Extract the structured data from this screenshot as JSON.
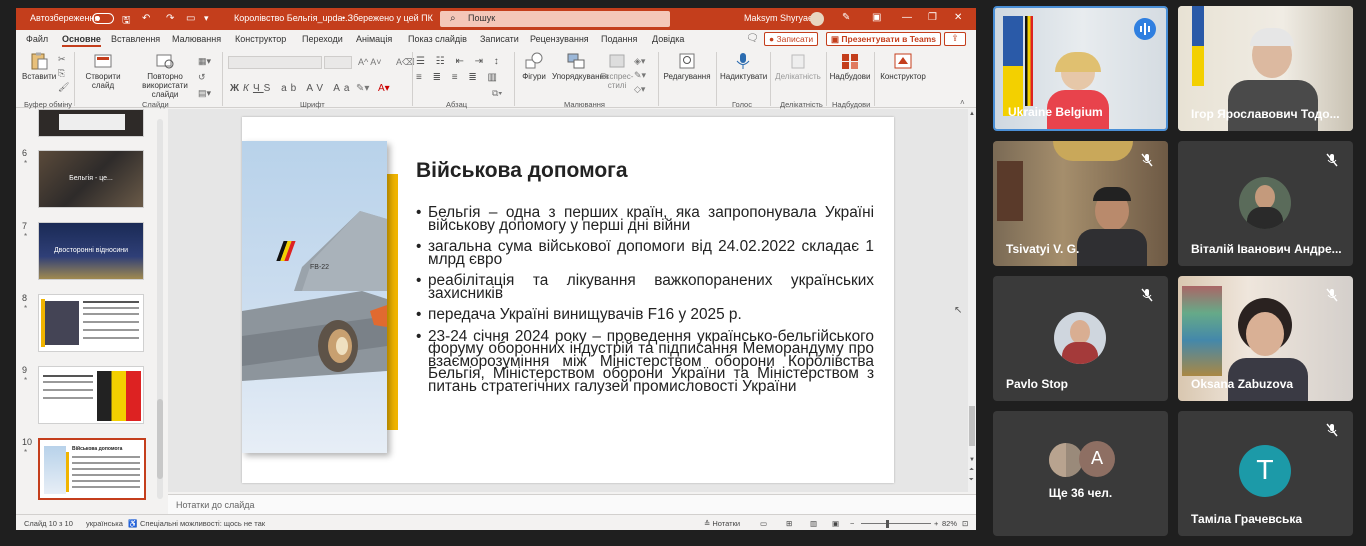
{
  "ppt": {
    "titlebar": {
      "autosave_label": "Автозбереження",
      "doc_title": "Королівство Бельгія_upda...",
      "saved_status": "• Збережено у цей ПК",
      "search_placeholder": "Пошук",
      "user_name": "Maksym Shyryaev"
    },
    "menu": [
      "Файл",
      "Основне",
      "Вставлення",
      "Малювання",
      "Конструктор",
      "Переходи",
      "Анімація",
      "Показ слайдів",
      "Записати",
      "Рецензування",
      "Подання",
      "Довідка"
    ],
    "menu_active": "Основне",
    "record_label": "Записати",
    "teams_label": "Презентувати в Teams",
    "ribbon": {
      "paste": "Вставити",
      "clipboard_group": "Буфер обміну",
      "new_slide": "Створити слайд",
      "reuse_slides": "Повторно використати слайди",
      "slides_group": "Слайди",
      "font_group": "Шрифт",
      "paragraph_group": "Абзац",
      "shapes": "Фігури",
      "arrange": "Упорядкування",
      "quick_styles": "Експрес-стилі",
      "drawing_group": "Малювання",
      "editing": "Редагування",
      "dictate": "Надиктувати",
      "voice_group": "Голос",
      "sensitivity": "Делікатність",
      "sensitivity_group": "Делікатність",
      "addins": "Надбудови",
      "addins_group": "Надбудови",
      "designer": "Конструктор"
    },
    "thumbnails": [
      {
        "num": "6",
        "caption": "Бельгія - це..."
      },
      {
        "num": "7",
        "caption": "Двосторонні відносини"
      },
      {
        "num": "8",
        "caption": ""
      },
      {
        "num": "9",
        "caption": ""
      },
      {
        "num": "10",
        "caption": "Військова допомога"
      }
    ],
    "slide": {
      "title": "Військова допомога",
      "bullets": [
        "Бельгія – одна з перших країн, яка запропонувала Україні військову допомогу у перші дні війни",
        "загальна сума військової допомоги від 24.02.2022 складає 1 млрд євро",
        "реабілітація та лікування важкопоранених українських захисників",
        "передача Україні винищувачів F16 у 2025 р.",
        "23-24 січня 2024 року – проведення українсько-бельгійського форуму оборонних індустрій та підписання Меморандуму про взаєморозуміння між Міністерством оборони Королівства Бельгія, Міністерством оборони України та Міністерством з питань стратегічних галузей промисловості України"
      ],
      "jet_code": "FB-22"
    },
    "notes_placeholder": "Нотатки до слайда",
    "status": {
      "slide_info": "Слайд 10 з 10",
      "language": "українська",
      "accessibility": "Спеціальні можливості: щось не так",
      "notes": "Нотатки",
      "zoom": "82%"
    }
  },
  "participants": [
    {
      "name": "Ukraine Belgium",
      "active": true
    },
    {
      "name": "Ігор Ярославович Тодо..."
    },
    {
      "name": "Tsivatyi V. G."
    },
    {
      "name": "Віталій Іванович Андре..."
    },
    {
      "name": "Pavlo Stop"
    },
    {
      "name": "Oksana Zabuzova"
    },
    {
      "name": "Ще 36 чел.",
      "letter": "A"
    },
    {
      "name": "Таміла Грачевська",
      "letter": "T"
    }
  ],
  "colors": {
    "ppt_accent": "#c43e1c",
    "slide_yellow": "#f0b400",
    "active_tile_border": "#4a8fd6",
    "avatar_teal": "#1c9aa8",
    "avatar_grey": "#8e6f63"
  }
}
